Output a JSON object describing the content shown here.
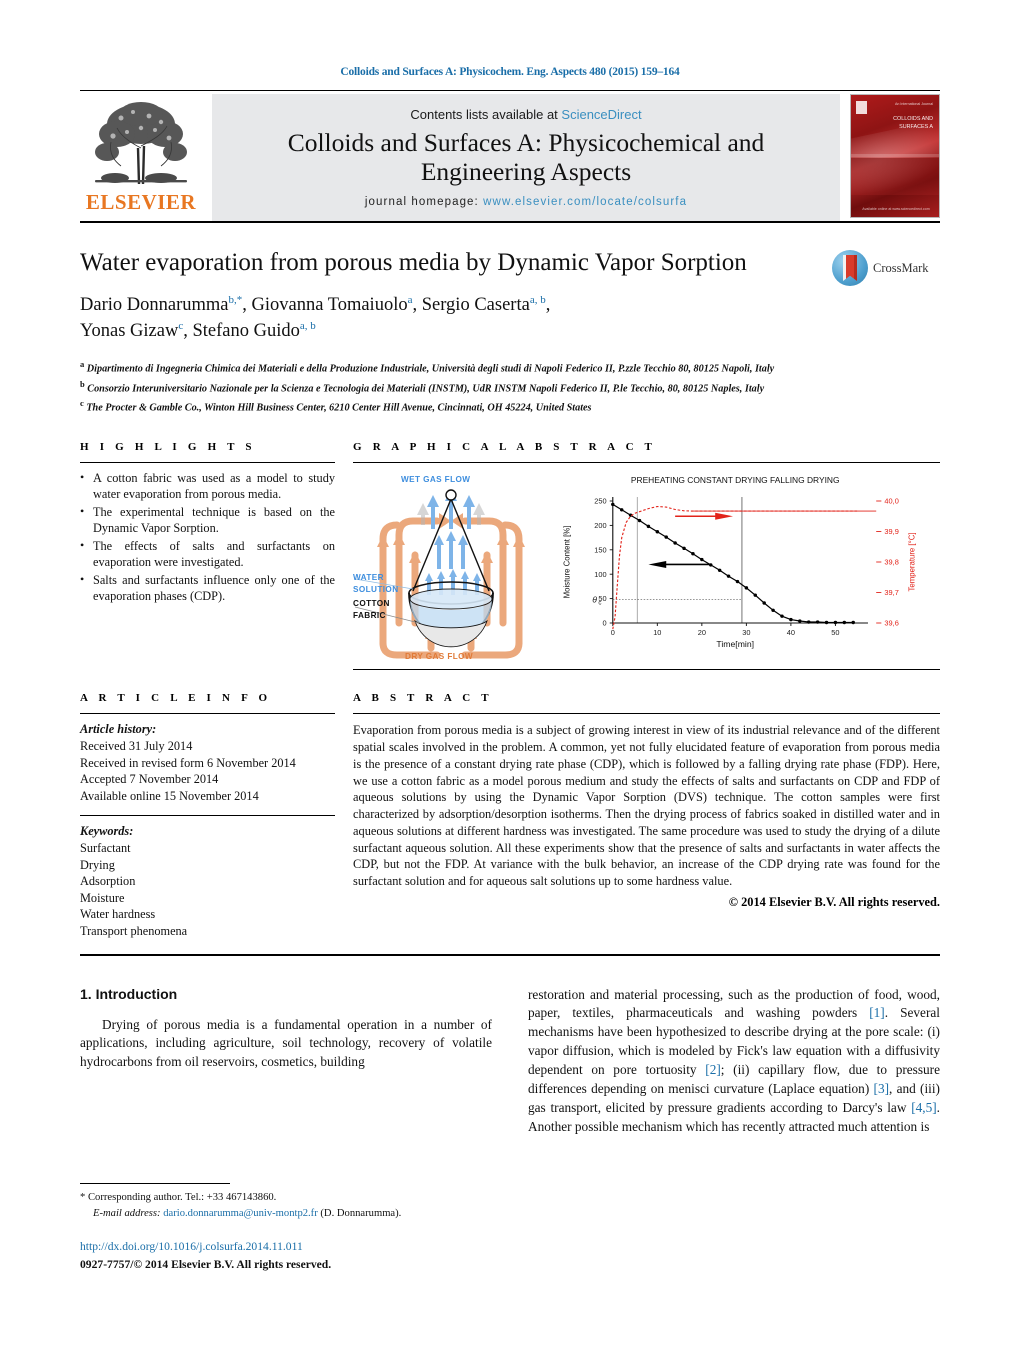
{
  "running_head": "Colloids and Surfaces A: Physicochem. Eng. Aspects 480 (2015) 159–164",
  "masthead": {
    "publisher_wordmark": "ELSEVIER",
    "contents_prefix": "Contents lists available at ",
    "contents_link": "ScienceDirect",
    "journal_name_line1": "Colloids and Surfaces A: Physicochemical and",
    "journal_name_line2": "Engineering Aspects",
    "homepage_prefix": "journal homepage: ",
    "homepage_url": "www.elsevier.com/locate/colsurfa",
    "cover_title_line1": "COLLOIDS AND",
    "cover_title_line2": "SURFACES A",
    "cover_sub": "Physicochemical and\nEngineering Aspects",
    "cover_top_text": "An International Journal",
    "cover_bottom_text": "Available online at www.sciencedirect.com"
  },
  "article": {
    "title": "Water evaporation from porous media by Dynamic Vapor Sorption",
    "crossmark_label": "CrossMark",
    "authors_line1": "Dario Donnarumma",
    "authors_line1_sup": "b,*",
    "authors_line1b": ", Giovanna Tomaiuolo",
    "authors_line1b_sup": "a",
    "authors_line1c": ", Sergio Caserta",
    "authors_line1c_sup": "a, b",
    "authors_line1d": ",",
    "authors_line2": "Yonas Gizaw",
    "authors_line2_sup": "c",
    "authors_line2b": ", Stefano Guido",
    "authors_line2b_sup": "a, b",
    "affiliations": [
      {
        "marker": "a",
        "text": "Dipartimento di Ingegneria Chimica dei Materiali e della Produzione Industriale, Università degli studi di Napoli Federico II, P.zzle Tecchio 80, 80125 Napoli, Italy"
      },
      {
        "marker": "b",
        "text": "Consorzio Interuniversitario Nazionale per la Scienza e Tecnologia dei Materiali (INSTM), UdR INSTM Napoli Federico II, P.le Tecchio, 80, 80125 Naples, Italy"
      },
      {
        "marker": "c",
        "text": "The Procter & Gamble Co., Winton Hill Business Center, 6210 Center Hill Avenue, Cincinnati, OH 45224, United States"
      }
    ]
  },
  "highlights": {
    "heading": "H I G H L I G H T S",
    "items": [
      "A cotton fabric was used as a model to study water evaporation from porous media.",
      "The experimental technique is based on the Dynamic Vapor Sorption.",
      "The effects of salts and surfactants on evaporation were investigated.",
      "Salts and surfactants influence only one of the evaporation phases (CDP)."
    ]
  },
  "graphical_abstract": {
    "heading": "G R A P H I C A L   A B S T R A C T",
    "diagram": {
      "wet_gas_flow": "WET GAS FLOW",
      "dry_gas_flow": "DRY GAS FLOW",
      "water": "WATER",
      "solution": "SOLUTION",
      "cotton": "COTTON",
      "fabric": "FABRIC"
    }
  },
  "chart_data": {
    "type": "line",
    "title": "PREHEATING  CONSTANT DRYING  FALLING DRYING",
    "phase_labels": [
      "PREHEATING",
      "CONSTANT DRYING",
      "FALLING DRYING"
    ],
    "xlabel": "Time[min]",
    "ylabel": "Moisture Content [%]",
    "y2label": "Temperature [°C]",
    "xlim": [
      0,
      55
    ],
    "ylim": [
      0,
      250
    ],
    "y2lim": [
      39.6,
      40.0
    ],
    "xticks": [
      0,
      10,
      20,
      30,
      40,
      50
    ],
    "yticks": [
      0,
      50,
      100,
      150,
      200,
      250
    ],
    "y2ticks": [
      "39.6",
      "39.7",
      "39.8",
      "39.9",
      "40.0"
    ],
    "grid": false,
    "legend": "none",
    "annotations": [
      {
        "text": "θc",
        "x": 0.5,
        "y": 50
      },
      {
        "text": "phase boundary",
        "x": 5.5
      },
      {
        "text": "phase boundary",
        "x": 29
      }
    ],
    "series": [
      {
        "name": "Moisture Content",
        "color": "#000000",
        "axis": "left",
        "x": [
          0,
          2,
          4,
          6,
          8,
          10,
          12,
          14,
          16,
          18,
          20,
          22,
          24,
          26,
          28,
          30,
          32,
          34,
          36,
          38,
          40,
          42,
          44,
          46,
          48,
          50,
          52,
          54
        ],
        "y": [
          243,
          232,
          221,
          210,
          198,
          187,
          176,
          164,
          153,
          142,
          130,
          119,
          108,
          96,
          85,
          72,
          57,
          41,
          26,
          14,
          7,
          4,
          2,
          2,
          1,
          1,
          1,
          1
        ]
      },
      {
        "name": "Temperature",
        "color": "#e2231a",
        "axis": "right",
        "x": [
          0,
          0.5,
          1,
          1.5,
          2,
          3,
          4,
          5,
          6,
          8,
          10,
          12,
          14,
          16,
          18,
          22,
          30,
          40,
          50,
          55
        ],
        "y": [
          39.58,
          39.62,
          39.72,
          39.82,
          39.88,
          39.93,
          39.95,
          39.96,
          39.965,
          39.975,
          39.982,
          39.98,
          39.972,
          39.968,
          39.967,
          39.967,
          39.967,
          39.967,
          39.967,
          39.967
        ]
      }
    ]
  },
  "article_info": {
    "heading": "A R T I C L E    I N F O",
    "history_label": "Article history:",
    "history": [
      "Received 31 July 2014",
      "Received in revised form 6 November 2014",
      "Accepted 7 November 2014",
      "Available online 15 November 2014"
    ],
    "keywords_label": "Keywords:",
    "keywords": [
      "Surfactant",
      "Drying",
      "Adsorption",
      "Moisture",
      "Water hardness",
      "Transport phenomena"
    ]
  },
  "abstract": {
    "heading": "A B S T R A C T",
    "text": "Evaporation from porous media is a subject of growing interest in view of its industrial relevance and of the different spatial scales involved in the problem. A common, yet not fully elucidated feature of evaporation from porous media is the presence of a constant drying rate phase (CDP), which is followed by a falling drying rate phase (FDP). Here, we use a cotton fabric as a model porous medium and study the effects of salts and surfactants on CDP and FDP of aqueous solutions by using the Dynamic Vapor Sorption (DVS) technique. The cotton samples were first characterized by adsorption/desorption isotherms. Then the drying process of fabrics soaked in distilled water and in aqueous solutions at different hardness was investigated. The same procedure was used to study the drying of a dilute surfactant aqueous solution. All these experiments show that the presence of salts and surfactants in water affects the CDP, but not the FDP. At variance with the bulk behavior, an increase of the CDP drying rate was found for the surfactant solution and for aqueous salt solutions up to some hardness value.",
    "copyright": "© 2014 Elsevier B.V. All rights reserved."
  },
  "body": {
    "section_heading": "1.  Introduction",
    "col1_para1": "Drying of porous media is a fundamental operation in a number of applications, including agriculture, soil technology, recovery of volatile hydrocarbons from oil reservoirs, cosmetics, building",
    "col2_para_a": "restoration and material processing, such as the production of food, wood, paper, textiles, pharmaceuticals and washing powders ",
    "col2_ref1": "[1]",
    "col2_para_b": ". Several mechanisms have been hypothesized to describe drying at the pore scale: (i) vapor diffusion, which is modeled by Fick's law equation with a diffusivity dependent on pore tortuosity ",
    "col2_ref2": "[2]",
    "col2_para_c": "; (ii) capillary flow, due to pressure differences depending on menisci curvature (Laplace equation) ",
    "col2_ref3": "[3]",
    "col2_para_d": ", and (iii) gas transport, elicited by pressure gradients according to Darcy's law ",
    "col2_ref4": "[4,5]",
    "col2_para_e": ". Another possible mechanism which has recently attracted much attention is"
  },
  "footer": {
    "corresponding_marker": "*",
    "corresponding_text": "Corresponding author. Tel.: +33 467143860.",
    "email_label": "E-mail address:",
    "email": "dario.donnarumma@univ-montp2.fr",
    "email_suffix": "(D. Donnarumma).",
    "doi": "http://dx.doi.org/10.1016/j.colsurfa.2014.11.011",
    "issn_line": "0927-7757/© 2014 Elsevier B.V. All rights reserved."
  },
  "colors": {
    "link": "#1a6ea8",
    "elsevier_orange": "#e87722",
    "band_gray": "#e7e8ea",
    "chart_red": "#e2231a",
    "diagram_blue": "#3e8ede",
    "diagram_orange": "#e8a87c"
  }
}
